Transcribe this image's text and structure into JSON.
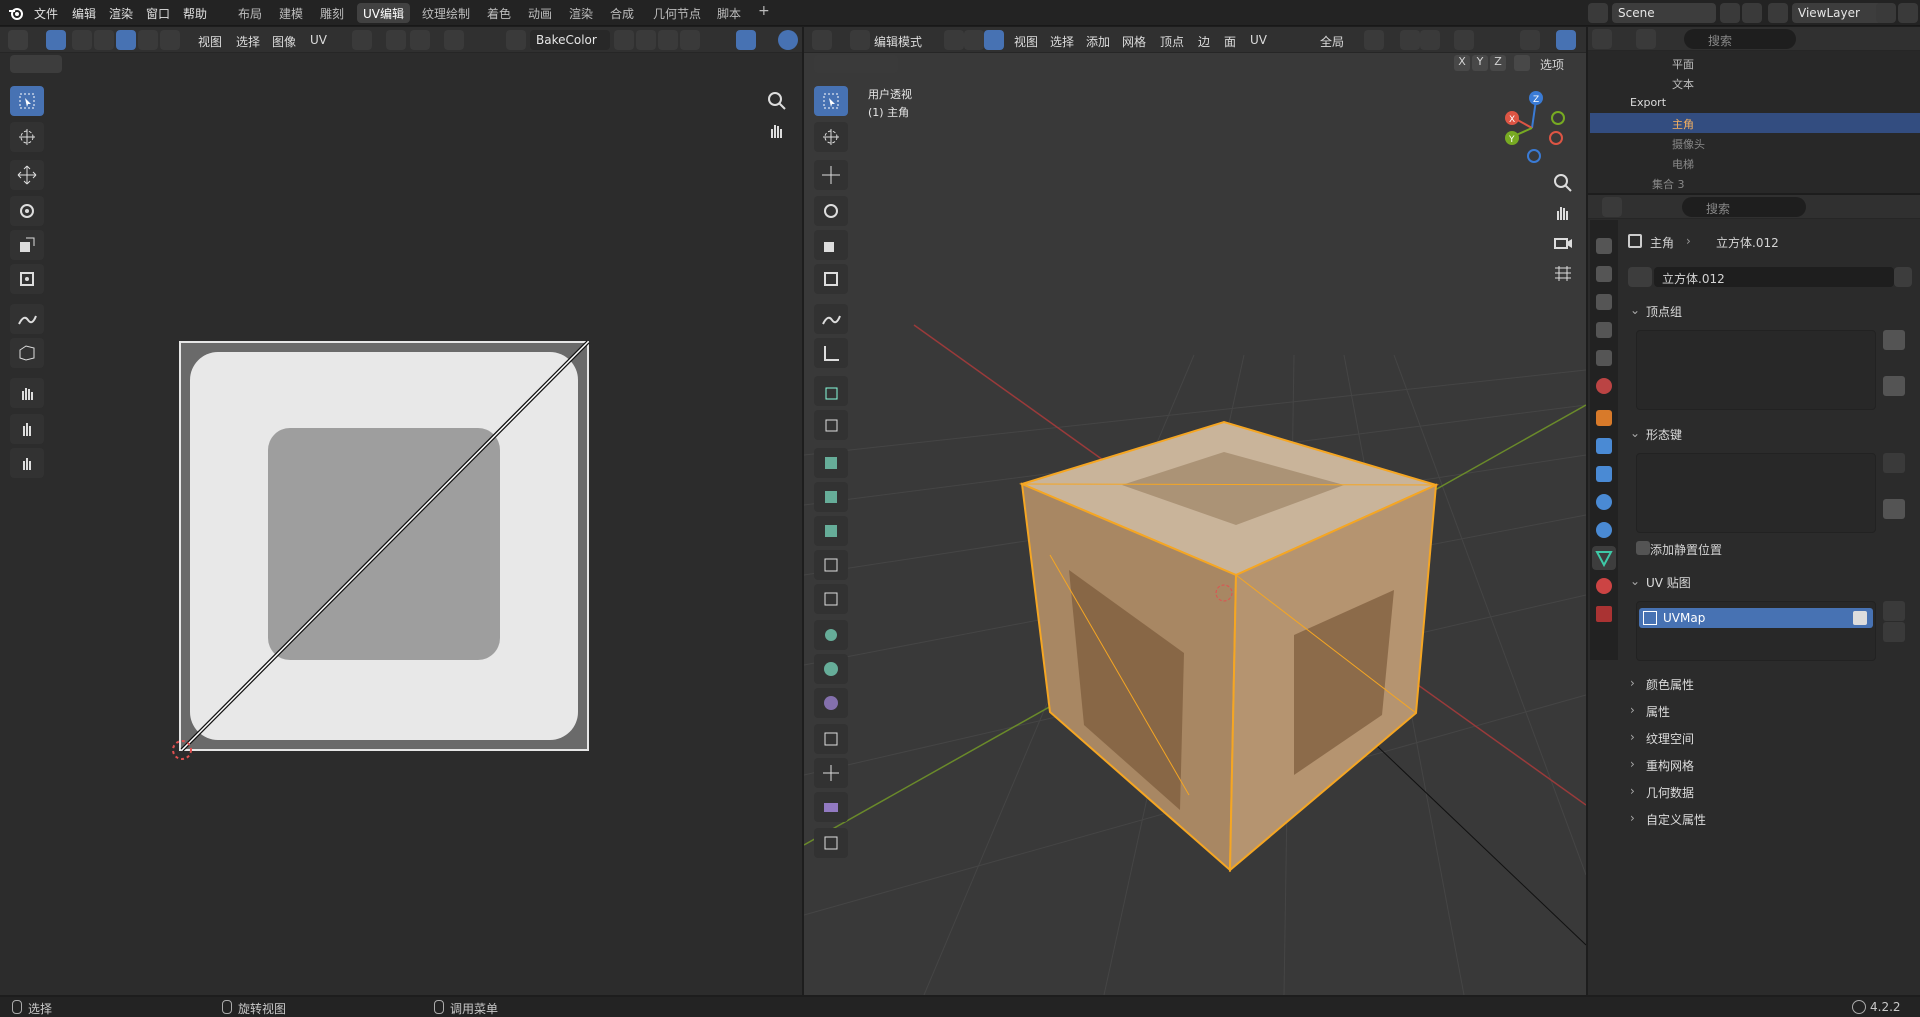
{
  "topbar": {
    "menus": [
      "文件",
      "编辑",
      "渲染",
      "窗口",
      "帮助"
    ],
    "workspaces": [
      "布局",
      "建模",
      "雕刻",
      "UV编辑",
      "纹理绘制",
      "着色",
      "动画",
      "渲染",
      "合成",
      "几何节点",
      "脚本"
    ],
    "active_workspace": "UV编辑",
    "add_tab": "+",
    "scene": "Scene",
    "view_layer": "ViewLayer"
  },
  "uv_editor": {
    "menus": [
      "视图",
      "选择",
      "图像",
      "UV"
    ],
    "image_name": "BakeColor"
  },
  "viewport": {
    "mode": "编辑模式",
    "menus": [
      "视图",
      "选择",
      "添加",
      "网格",
      "顶点",
      "边",
      "面",
      "UV"
    ],
    "transform_orientation": "全局",
    "axes": [
      "X",
      "Y",
      "Z"
    ],
    "options_label": "选项",
    "view_name": "用户透视",
    "object_label": "(1) 主角",
    "gizmo": {
      "z": "Z",
      "x": "X",
      "y": "Y"
    }
  },
  "outliner": {
    "search_placeholder": "搜索",
    "rows": [
      {
        "label": "平面",
        "selected": false
      },
      {
        "label": "文本",
        "selected": false
      },
      {
        "label": "Export",
        "selected": false
      },
      {
        "label": "主角",
        "selected": true
      },
      {
        "label": "摄像头",
        "selected": false
      },
      {
        "label": "电梯",
        "selected": false
      },
      {
        "label": "集合 3",
        "selected": false
      }
    ]
  },
  "properties": {
    "search_placeholder": "搜索",
    "breadcrumb_object": "主角",
    "breadcrumb_mesh": "立方体.012",
    "mesh_name": "立方体.012",
    "sections": {
      "vertex_groups": "顶点组",
      "shape_keys": "形态键",
      "add_rest_position": "添加静置位置",
      "uv_maps": "UV 贴图",
      "uv_map_item": "UVMap",
      "color_attributes": "颜色属性",
      "attributes": "属性",
      "texture_space": "纹理空间",
      "remesh": "重构网格",
      "geometry_data": "几何数据",
      "custom_props": "自定义属性"
    }
  },
  "statusbar": {
    "select": "选择",
    "rotate_view": "旋转视图",
    "call_menu": "调用菜单",
    "version": "4.2.2"
  },
  "colors": {
    "accent": "#4772b3",
    "selection_orange": "#f5a623",
    "active_tab": "#414141"
  }
}
